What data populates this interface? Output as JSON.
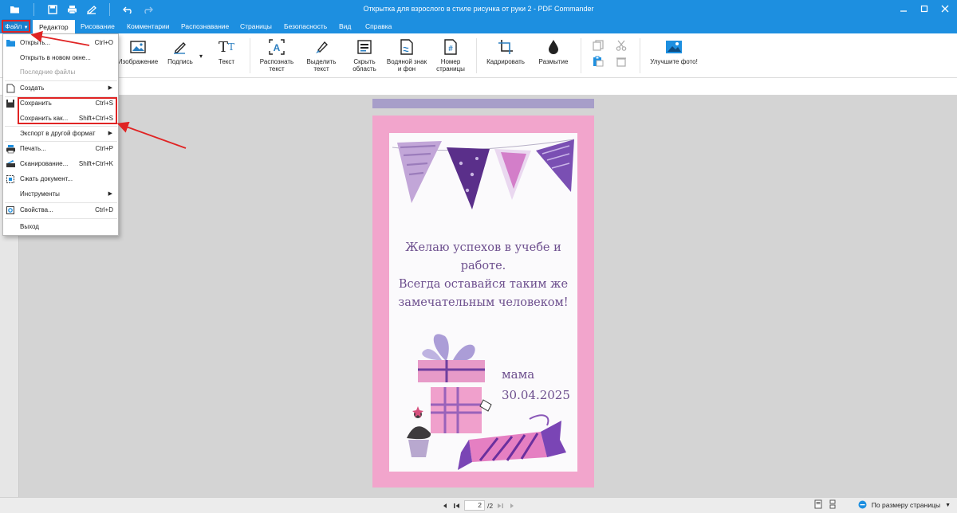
{
  "window": {
    "title": "Открытка для взрослого в стиле рисунка от руки 2 - PDF Commander"
  },
  "tabs": {
    "file": "Файл",
    "editor": "Редактор",
    "drawing": "Рисование",
    "comments": "Комментарии",
    "recognition": "Распознавание",
    "pages": "Страницы",
    "security": "Безопасность",
    "view": "Вид",
    "help": "Справка"
  },
  "ribbon": {
    "image": "Изображение",
    "signature": "Подпись",
    "text": "Текст",
    "recognize_text_1": "Распознать",
    "recognize_text_2": "текст",
    "select_text_1": "Выделить",
    "select_text_2": "текст",
    "hide_area_1": "Скрыть",
    "hide_area_2": "область",
    "watermark_1": "Водяной знак",
    "watermark_2": "и фон",
    "page_number_1": "Номер",
    "page_number_2": "страницы",
    "crop": "Кадрировать",
    "blur": "Размытие",
    "enhance_photo": "Улучшите фото!"
  },
  "file_menu": {
    "open": "Открыть...",
    "open_shortcut": "Ctrl+O",
    "open_new_window": "Открыть в новом окне...",
    "recent_files": "Последние файлы",
    "create": "Создать",
    "save": "Сохранить",
    "save_shortcut": "Ctrl+S",
    "save_as": "Сохранить как...",
    "save_as_shortcut": "Shift+Ctrl+S",
    "export": "Экспорт в другой формат",
    "print": "Печать...",
    "print_shortcut": "Ctrl+P",
    "scan": "Сканирование...",
    "scan_shortcut": "Shift+Ctrl+K",
    "compress": "Сжать документ...",
    "tools": "Инструменты",
    "properties": "Свойства...",
    "properties_shortcut": "Ctrl+D",
    "exit": "Выход"
  },
  "card": {
    "message_line1": "Желаю успехов в учебе и работе.",
    "message_line2": "Всегда оставайся таким же",
    "message_line3": "замечательным человеком!",
    "name": "мама",
    "date": "30.04.2025"
  },
  "statusbar": {
    "current_page": "2",
    "total_pages": "/2",
    "zoom_mode": "По размеру страницы"
  },
  "colors": {
    "accent": "#1d8fe0",
    "highlight": "#e02424",
    "card_border": "#f2a5cc",
    "card_text": "#6d4f8e"
  }
}
